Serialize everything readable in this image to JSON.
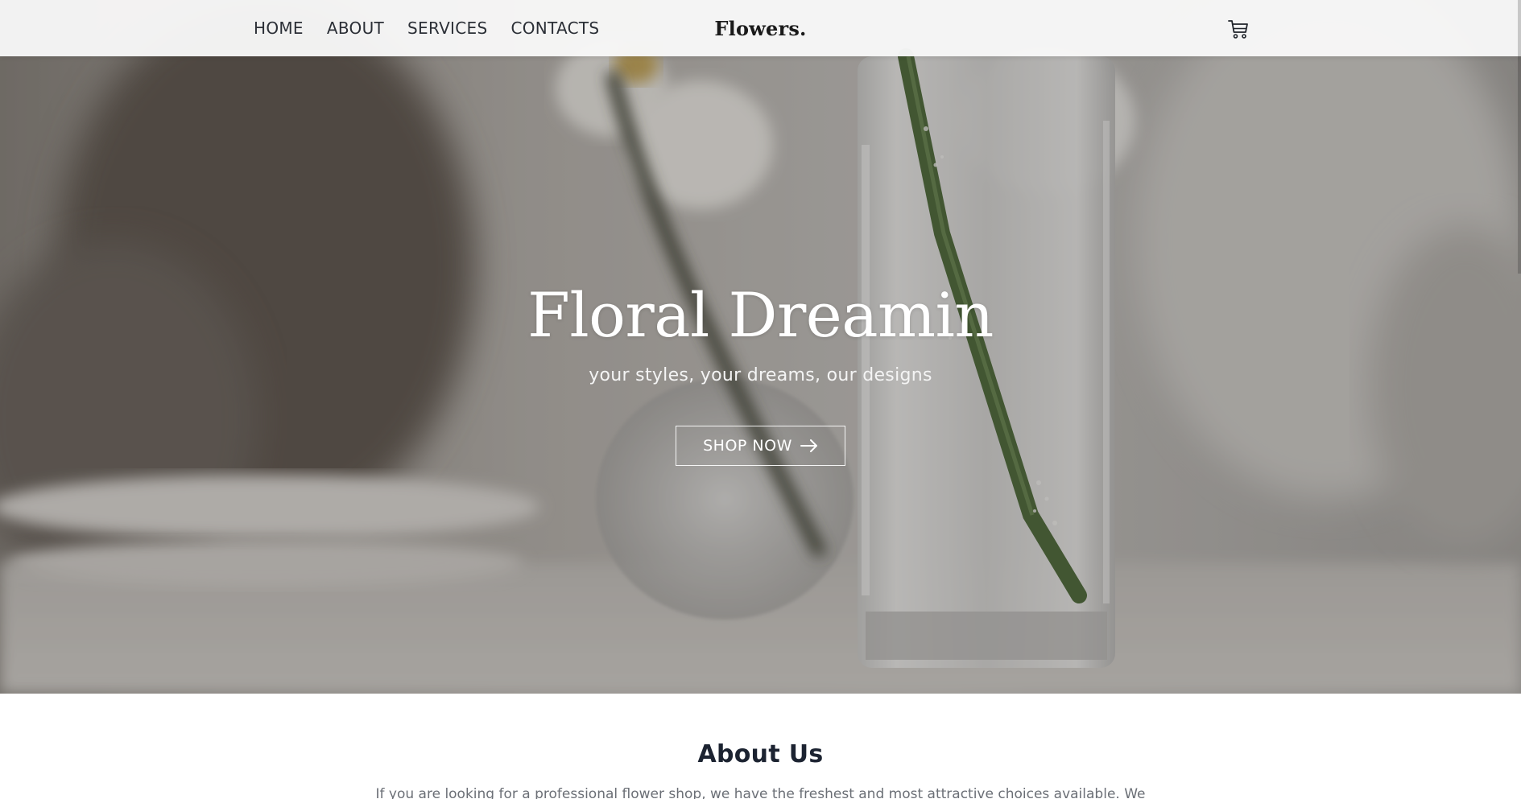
{
  "header": {
    "nav": [
      {
        "label": "HOME"
      },
      {
        "label": "ABOUT"
      },
      {
        "label": "SERVICES"
      },
      {
        "label": "CONTACTS"
      }
    ],
    "logo": "Flowers.",
    "cart_icon": "shopping-cart-icon"
  },
  "hero": {
    "title": "Floral Dreamin",
    "subtitle": "your styles, your dreams, our designs",
    "button_label": "SHOP NOW",
    "button_icon": "arrow-right-icon"
  },
  "about": {
    "title": "About Us",
    "text": "If you are looking for a professional flower shop, we have the freshest and most attractive choices available. We"
  },
  "colors": {
    "header_bg": "#f8f8f8",
    "nav_text": "#2b2f36",
    "hero_text": "#ffffff",
    "about_title": "#1c2331",
    "about_text": "#6b6f76"
  }
}
